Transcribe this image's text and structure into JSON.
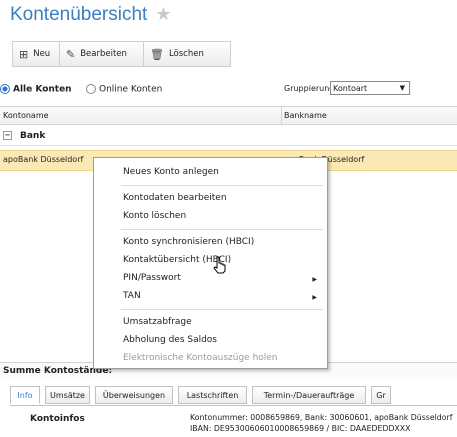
{
  "page": {
    "title": "Kontenübersicht",
    "favorite_icon": "star-icon"
  },
  "toolbar": {
    "new": {
      "label": "Neu",
      "icon": "new-document-icon"
    },
    "edit": {
      "label": "Bearbeiten",
      "icon": "edit-icon"
    },
    "delete": {
      "label": "Löschen",
      "icon": "trash-icon"
    }
  },
  "filter": {
    "all_accounts": "Alle Konten",
    "online_accounts": "Online Konten",
    "selected": "Alle Konten",
    "grouping_label": "Gruppierung",
    "grouping_value": "Kontoart"
  },
  "grid": {
    "columns": [
      "Kontoname",
      "Bankname"
    ],
    "group_label": "Bank",
    "rows": [
      {
        "account": "apoBank Düsseldorf",
        "bank": "apoBank Düsseldorf"
      }
    ]
  },
  "context_menu": {
    "items": [
      {
        "label": "Neues Konto anlegen"
      },
      {
        "label": "Kontodaten bearbeiten"
      },
      {
        "label": "Konto löschen"
      },
      {
        "label": "Konto synchronisieren (HBCI)"
      },
      {
        "label": "Kontaktübersicht (HBCI)"
      },
      {
        "label": "PIN/Passwort"
      },
      {
        "label": "TAN"
      },
      {
        "label": "Umsatzabfrage"
      },
      {
        "label": "Abholung des Saldos"
      },
      {
        "label": "Elektronische Kontoauszüge holen"
      }
    ]
  },
  "summary": {
    "label": "Summe Kontostände:"
  },
  "tabs": [
    "Info",
    "Umsätze",
    "Überweisungen",
    "Lastschriften",
    "Termin-/Daueraufträge",
    "Gr"
  ],
  "info": {
    "label": "Kontoinfos",
    "line1": "Kontonummer: 0008659869, Bank: 30060601, apoBank Düsseldorf",
    "line2": "IBAN: DE95300606010008659869 / BIC: DAAEDEDDXXX"
  },
  "colors": {
    "accent": "#3a7fc1",
    "selected_row": "#fbe9b5"
  }
}
